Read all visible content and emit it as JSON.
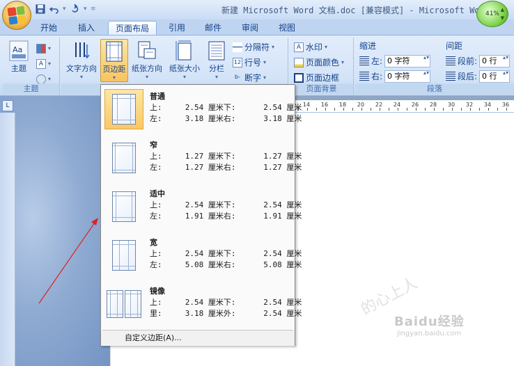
{
  "window": {
    "title": "新建 Microsoft Word 文档.doc [兼容模式] - Microsoft Wo",
    "badge": "41%"
  },
  "qat": {
    "save_icon": "save-icon",
    "undo_icon": "undo-icon",
    "redo_icon": "redo-icon"
  },
  "tabs": [
    {
      "label": "开始"
    },
    {
      "label": "插入"
    },
    {
      "label": "页面布局"
    },
    {
      "label": "引用"
    },
    {
      "label": "邮件"
    },
    {
      "label": "审阅"
    },
    {
      "label": "视图"
    }
  ],
  "ribbon": {
    "theme_group": {
      "label": "主题",
      "theme_button": "主题"
    },
    "page_setup": {
      "text_direction": "文字方向",
      "margins": "页边距",
      "orientation": "纸张方向",
      "size": "纸张大小",
      "columns": "分栏",
      "breaks": "分隔符",
      "line_numbers": "行号",
      "hyphenation": "断字"
    },
    "page_background": {
      "label": "页面背景",
      "watermark": "水印",
      "page_color": "页面颜色",
      "page_borders": "页面边框"
    },
    "paragraph": {
      "label": "段落",
      "indent_title": "缩进",
      "indent_left_label": "左:",
      "indent_left_value": "0 字符",
      "indent_right_label": "右:",
      "indent_right_value": "0 字符",
      "spacing_title": "间距",
      "spacing_before_label": "段前:",
      "spacing_before_value": "0 行",
      "spacing_after_label": "段后:",
      "spacing_after_value": "0 行"
    }
  },
  "ruler": {
    "corner": "L",
    "ticks": [
      "14",
      "16",
      "18",
      "20",
      "22",
      "24",
      "26",
      "28",
      "30",
      "32",
      "34",
      "36"
    ]
  },
  "margins_menu": {
    "options": [
      {
        "name": "普通",
        "line1": "上:     2.54 厘米下:      2.54 厘米",
        "line2": "左:     3.18 厘米右:      3.18 厘米",
        "selected": true
      },
      {
        "name": "窄",
        "line1": "上:     1.27 厘米下:      1.27 厘米",
        "line2": "左:     1.27 厘米右:      1.27 厘米",
        "selected": false
      },
      {
        "name": "适中",
        "line1": "上:     2.54 厘米下:      2.54 厘米",
        "line2": "左:     1.91 厘米右:      1.91 厘米",
        "selected": false
      },
      {
        "name": "宽",
        "line1": "上:     2.54 厘米下:      2.54 厘米",
        "line2": "左:     5.08 厘米右:      5.08 厘米",
        "selected": false
      },
      {
        "name": "镜像",
        "line1": "上:     2.54 厘米下:      2.54 厘米",
        "line2": "里:     3.18 厘米外:      2.54 厘米",
        "selected": false
      }
    ],
    "custom": "自定义边距(A)..."
  },
  "watermark": {
    "brand": "Baidu经验",
    "site": "jingyan.baidu.com",
    "handwriting": "的心上人"
  },
  "colors": {
    "accent": "#15428b",
    "selected_bg": "#f9c868",
    "arrow": "#e02020"
  }
}
